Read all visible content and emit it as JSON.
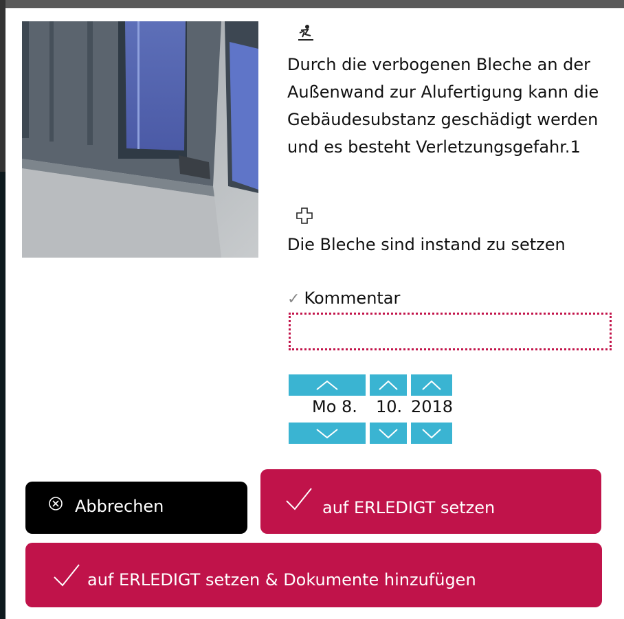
{
  "hazard": {
    "icon": "hazard-person-icon",
    "text": "Durch die verbogenen Bleche an der Außenwand zur Alufertigung kann die Gebäudesubstanz geschädigt werden und es besteht Verletzungsgefahr.1"
  },
  "measure": {
    "icon": "plus-outline-icon",
    "text": "Die Bleche sind instand zu setzen"
  },
  "comment": {
    "label": "Kommentar",
    "value": "",
    "placeholder": ""
  },
  "date": {
    "day": "Mo 8.",
    "month": "10.",
    "year": "2018"
  },
  "buttons": {
    "cancel": "Abbrechen",
    "done": "auf ERLEDIGT setzen",
    "done_docs": "auf ERLEDIGT setzen & Dokumente hinzufügen"
  },
  "colors": {
    "accent": "#c0134a",
    "stepper": "#3ab4d2",
    "cancel": "#000000"
  }
}
